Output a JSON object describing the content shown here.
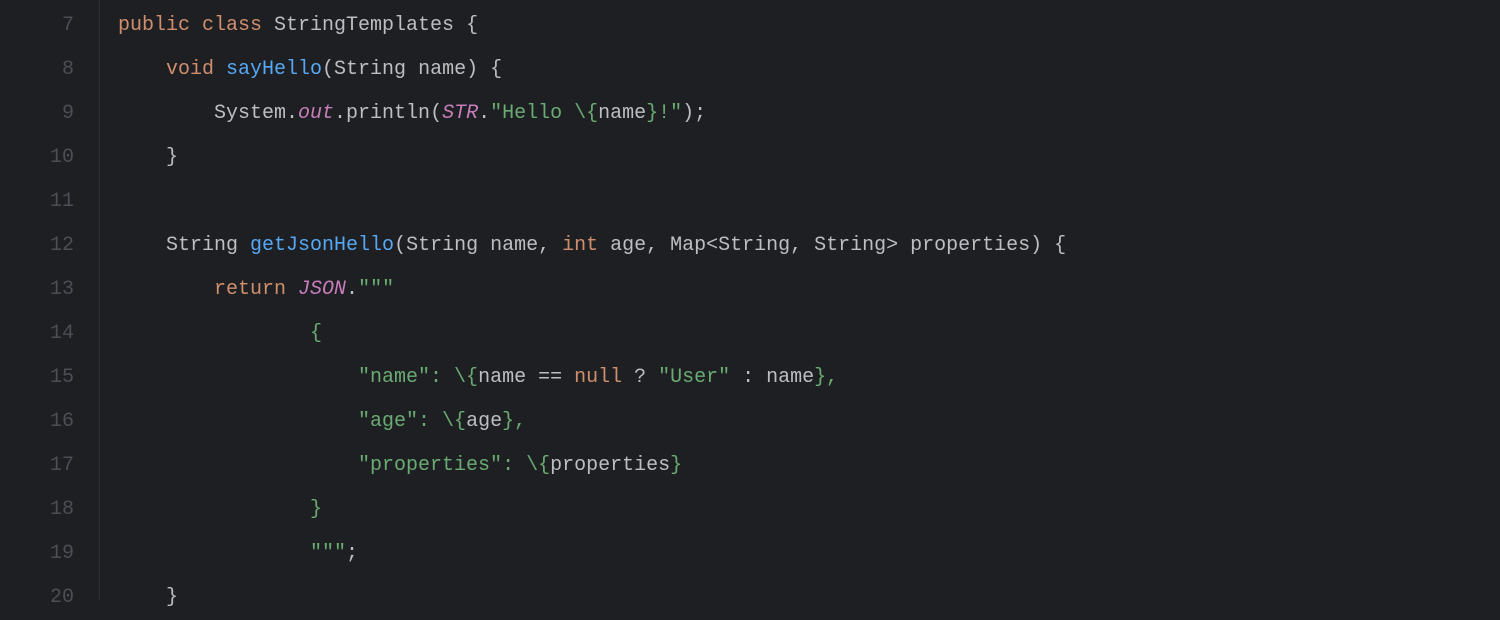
{
  "lineNumbers": [
    "7",
    "8",
    "9",
    "10",
    "11",
    "12",
    "13",
    "14",
    "15",
    "16",
    "17",
    "18",
    "19",
    "20"
  ],
  "code": {
    "l7": [
      {
        "c": "kw",
        "t": "public class "
      },
      {
        "c": "plain",
        "t": "StringTemplates {"
      }
    ],
    "l8": [
      {
        "c": "plain",
        "t": "    "
      },
      {
        "c": "kw",
        "t": "void "
      },
      {
        "c": "method",
        "t": "sayHello"
      },
      {
        "c": "plain",
        "t": "(String name) {"
      }
    ],
    "l9": [
      {
        "c": "plain",
        "t": "        System."
      },
      {
        "c": "field-it",
        "t": "out"
      },
      {
        "c": "plain",
        "t": ".println("
      },
      {
        "c": "field-it",
        "t": "STR"
      },
      {
        "c": "plain",
        "t": "."
      },
      {
        "c": "str",
        "t": "\"Hello \\{"
      },
      {
        "c": "plain",
        "t": "name"
      },
      {
        "c": "str",
        "t": "}!\""
      },
      {
        "c": "plain",
        "t": ");"
      }
    ],
    "l10": [
      {
        "c": "plain",
        "t": "    }"
      }
    ],
    "l11": [
      {
        "c": "plain",
        "t": ""
      }
    ],
    "l12": [
      {
        "c": "plain",
        "t": "    String "
      },
      {
        "c": "method",
        "t": "getJsonHello"
      },
      {
        "c": "plain",
        "t": "(String name, "
      },
      {
        "c": "kw",
        "t": "int "
      },
      {
        "c": "plain",
        "t": "age, Map<String, String> properties) {"
      }
    ],
    "l13": [
      {
        "c": "plain",
        "t": "        "
      },
      {
        "c": "kw",
        "t": "return "
      },
      {
        "c": "field-it",
        "t": "JSON"
      },
      {
        "c": "plain",
        "t": "."
      },
      {
        "c": "str",
        "t": "\"\"\""
      }
    ],
    "l14": [
      {
        "c": "str",
        "t": "                {"
      }
    ],
    "l15": [
      {
        "c": "str",
        "t": "                    \"name\": \\{"
      },
      {
        "c": "plain",
        "t": "name == "
      },
      {
        "c": "kw",
        "t": "null "
      },
      {
        "c": "plain",
        "t": "? "
      },
      {
        "c": "str",
        "t": "\"User\""
      },
      {
        "c": "plain",
        "t": " : name"
      },
      {
        "c": "str",
        "t": "},"
      }
    ],
    "l16": [
      {
        "c": "str",
        "t": "                    \"age\": \\{"
      },
      {
        "c": "plain",
        "t": "age"
      },
      {
        "c": "str",
        "t": "},"
      }
    ],
    "l17": [
      {
        "c": "str",
        "t": "                    \"properties\": \\{"
      },
      {
        "c": "plain",
        "t": "properties"
      },
      {
        "c": "str",
        "t": "}"
      }
    ],
    "l18": [
      {
        "c": "str",
        "t": "                }"
      }
    ],
    "l19": [
      {
        "c": "str",
        "t": "                \"\"\""
      },
      {
        "c": "plain",
        "t": ";"
      }
    ],
    "l20": [
      {
        "c": "plain",
        "t": "    }"
      }
    ]
  }
}
